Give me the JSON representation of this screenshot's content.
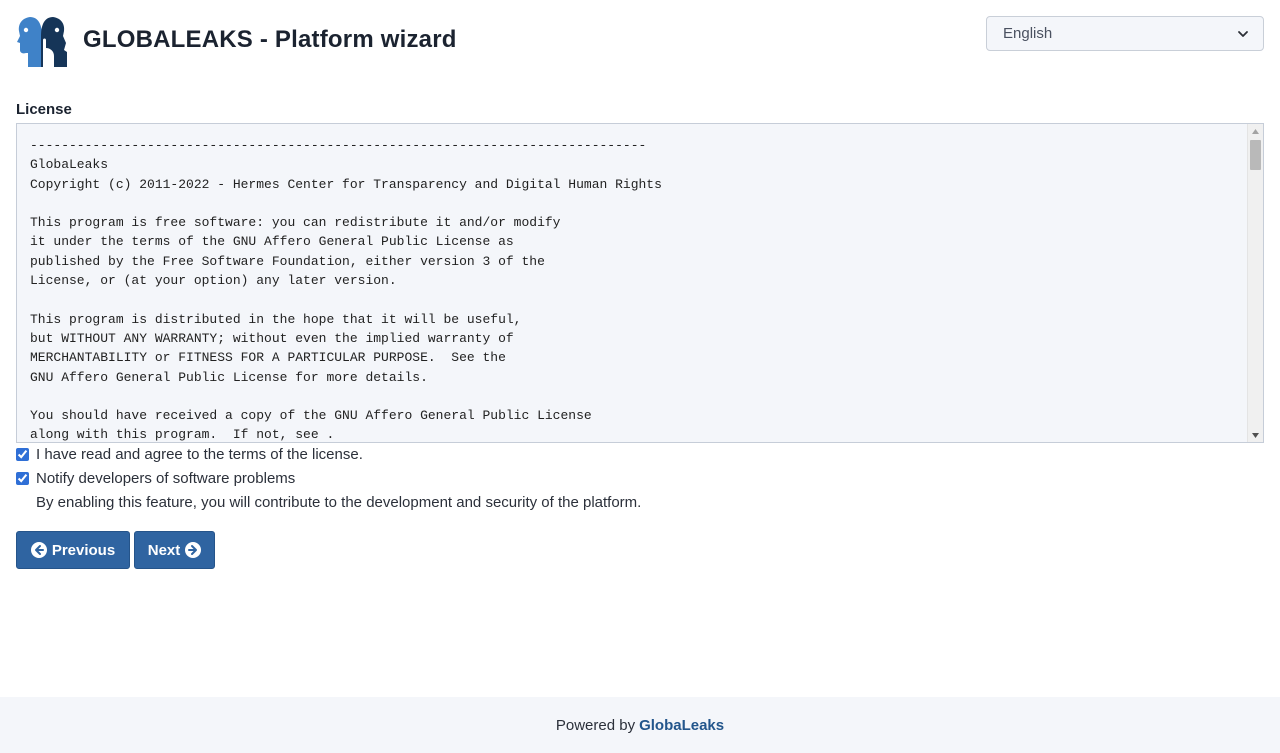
{
  "header": {
    "title": "GLOBALEAKS - Platform wizard",
    "logo_icon": "globaleaks-logo-icon",
    "language": {
      "selected": "English",
      "options": [
        "English"
      ]
    }
  },
  "license": {
    "label": "License",
    "text": "-------------------------------------------------------------------------------\nGlobaLeaks\nCopyright (c) 2011-2022 - Hermes Center for Transparency and Digital Human Rights\n\nThis program is free software: you can redistribute it and/or modify\nit under the terms of the GNU Affero General Public License as\npublished by the Free Software Foundation, either version 3 of the\nLicense, or (at your option) any later version.\n\nThis program is distributed in the hope that it will be useful,\nbut WITHOUT ANY WARRANTY; without even the implied warranty of\nMERCHANTABILITY or FITNESS FOR A PARTICULAR PURPOSE.  See the\nGNU Affero General Public License for more details.\n\nYou should have received a copy of the GNU Affero General Public License\nalong with this program.  If not, see ."
  },
  "options": {
    "agree_label": "I have read and agree to the terms of the license.",
    "agree_checked": true,
    "notify_label": "Notify developers of software problems",
    "notify_checked": true,
    "notify_note": "By enabling this feature, you will contribute to the development and security of the platform."
  },
  "nav": {
    "previous_label": "Previous",
    "next_label": "Next"
  },
  "footer": {
    "powered_by": "Powered by",
    "brand": "GlobaLeaks"
  },
  "colors": {
    "accent": "#2f64a1",
    "logo_light": "#3f82c8",
    "logo_dark": "#163558"
  }
}
